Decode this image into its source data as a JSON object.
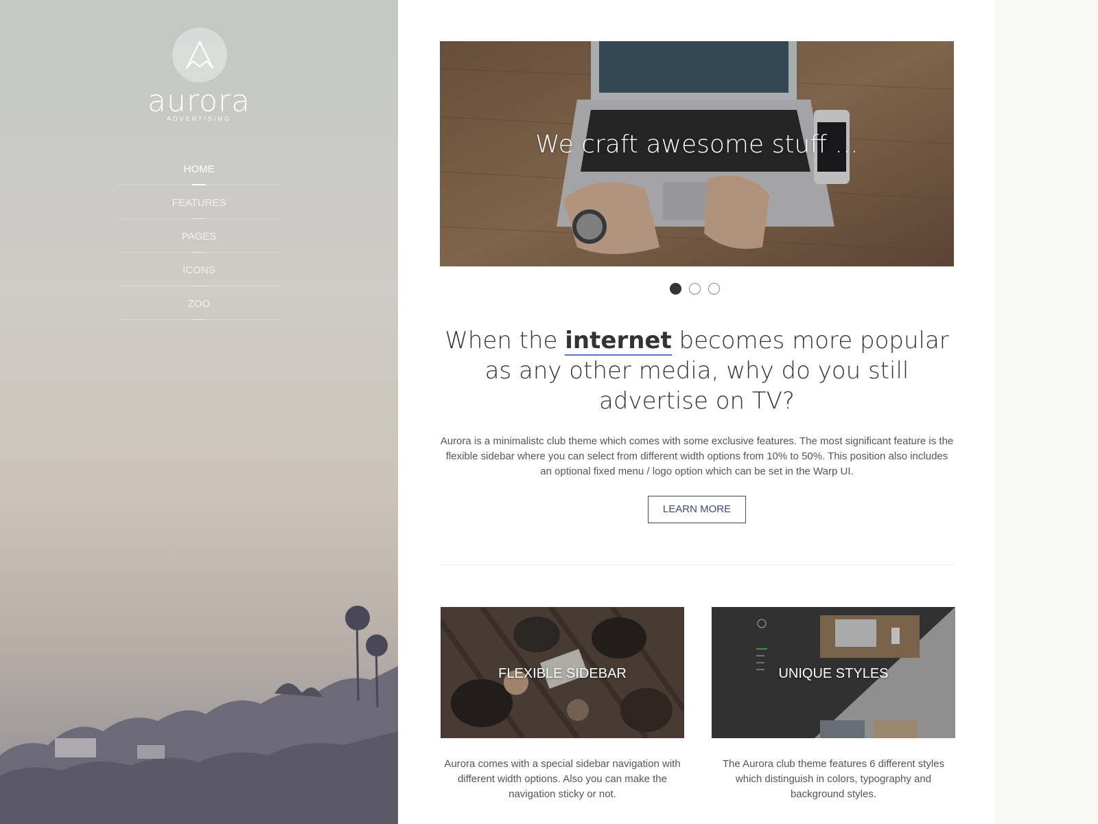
{
  "brand": {
    "name": "aurora",
    "tagline": "ADVERTISING"
  },
  "nav": [
    {
      "label": "HOME",
      "active": true
    },
    {
      "label": "FEATURES",
      "active": false
    },
    {
      "label": "PAGES",
      "active": false
    },
    {
      "label": "ICONS",
      "active": false
    },
    {
      "label": "ZOO",
      "active": false
    }
  ],
  "hero": {
    "caption": "We craft awesome stuff ...",
    "slide_count": 3,
    "active_slide": 1
  },
  "headline": {
    "before": "When the ",
    "highlight": "internet",
    "after": " becomes more popular as any other media, why do you still advertise on TV?"
  },
  "intro": "Aurora is a minimalistc club theme which comes with some exclusive features. The most significant feature is the flexible sidebar where you can select from different width options from 10% to 50%. This position also includes an optional fixed menu / logo option which can be set in the Warp UI.",
  "learn_more_label": "LEARN MORE",
  "features": [
    {
      "caption": "FLEXIBLE SIDEBAR",
      "text": "Aurora comes with a special sidebar navigation with different width options. Also you can make the navigation sticky or not."
    },
    {
      "caption": "UNIQUE STYLES",
      "text": "The Aurora club theme features 6 different styles which distinguish in colors, typography and background styles."
    }
  ],
  "colors": {
    "accent": "#5576c4",
    "button": "#3d4a74",
    "text": "#333333"
  }
}
